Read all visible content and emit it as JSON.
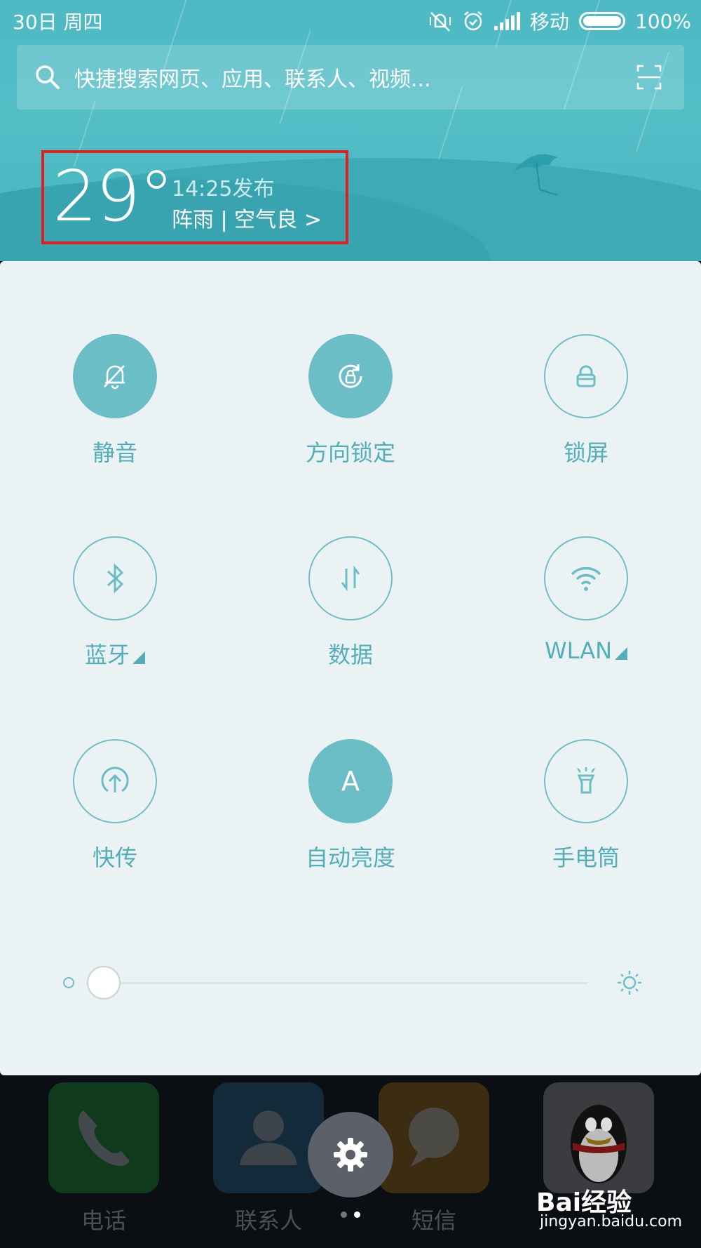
{
  "status_bar": {
    "date": "30日 周四",
    "carrier": "移动",
    "battery": "100%"
  },
  "search": {
    "placeholder": "快捷搜索网页、应用、联系人、视频..."
  },
  "weather": {
    "temperature": "29°",
    "publish_time": "14:25发布",
    "description": "阵雨 | 空气良 >"
  },
  "toggles": [
    {
      "label": "静音",
      "icon": "silent-bell-icon",
      "active": true
    },
    {
      "label": "方向锁定",
      "icon": "rotation-lock-icon",
      "active": true
    },
    {
      "label": "锁屏",
      "icon": "lock-icon",
      "active": false
    },
    {
      "label": "蓝牙",
      "icon": "bluetooth-icon",
      "active": false,
      "has_menu": true
    },
    {
      "label": "数据",
      "icon": "data-arrows-icon",
      "active": false
    },
    {
      "label": "WLAN",
      "icon": "wifi-icon",
      "active": false,
      "has_menu": true
    },
    {
      "label": "快传",
      "icon": "upload-icon",
      "active": false
    },
    {
      "label": "自动亮度",
      "icon": "auto-brightness-icon",
      "active": true,
      "glyph": "A"
    },
    {
      "label": "手电筒",
      "icon": "flashlight-icon",
      "active": false
    }
  ],
  "brightness": {
    "level": 0.0
  },
  "dock": [
    {
      "label": "电话",
      "icon": "phone-icon",
      "color": "#123a1c"
    },
    {
      "label": "联系人",
      "icon": "contacts-icon",
      "color": "#132b3a"
    },
    {
      "label": "短信",
      "icon": "message-icon",
      "color": "#3e2e12"
    },
    {
      "label": "",
      "icon": "qq-penguin-icon",
      "color": "#3a3c40"
    }
  ],
  "watermark": {
    "brand": "Bai经验",
    "url": "jingyan.baidu.com"
  },
  "colors": {
    "accent": "#6bbdc6",
    "highlight_box": "#e02020"
  }
}
